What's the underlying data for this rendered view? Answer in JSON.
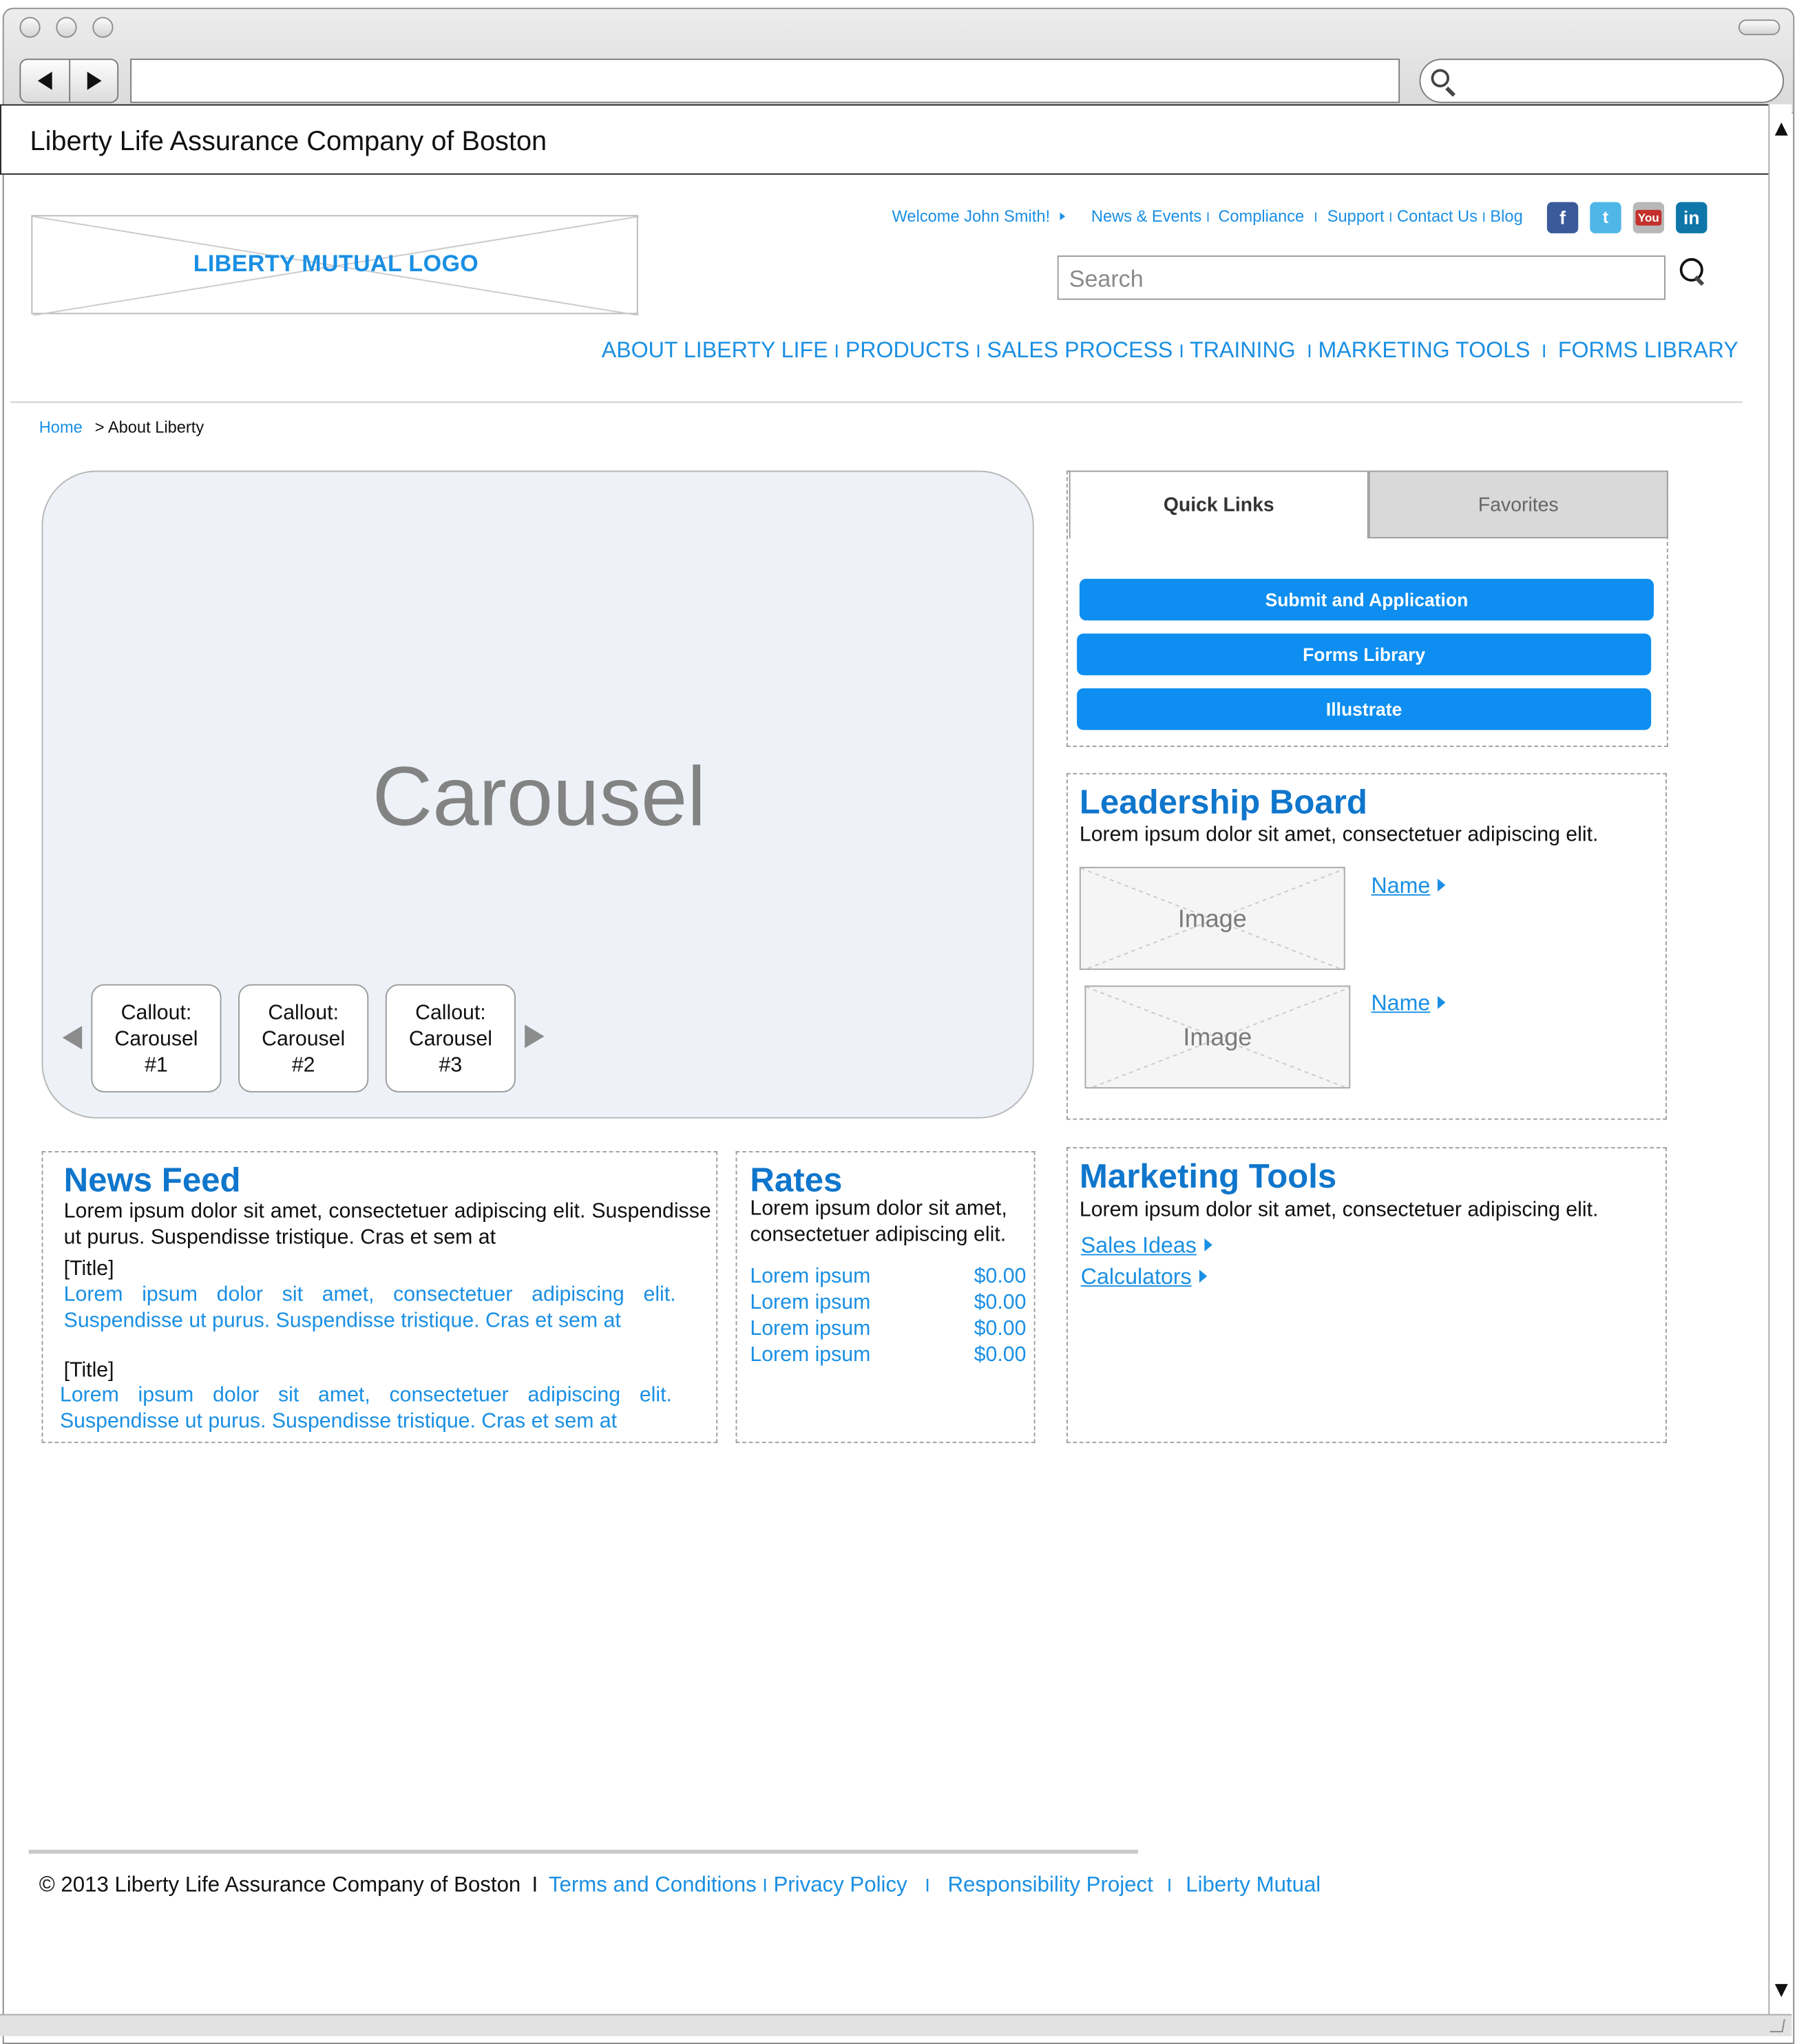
{
  "browser": {
    "url": "",
    "search": ""
  },
  "page_title": "Liberty Life Assurance Company of Boston",
  "logo_text": "LIBERTY MUTUAL LOGO",
  "top_links": {
    "welcome": "Welcome John Smith!",
    "news": "News & Events",
    "compliance": "Compliance",
    "support": "Support",
    "contact": "Contact Us",
    "blog": "Blog",
    "sep": "I"
  },
  "social": {
    "facebook": "f",
    "twitter": "t",
    "youtube": "You",
    "linkedin": "in"
  },
  "site_search": {
    "placeholder": "Search"
  },
  "main_nav": [
    "ABOUT LIBERTY LIFE",
    "PRODUCTS",
    "SALES PROCESS",
    "TRAINING",
    "MARKETING TOOLS",
    "FORMS LIBRARY"
  ],
  "breadcrumb": {
    "home": "Home",
    "sep": ">",
    "current": "About Liberty"
  },
  "carousel": {
    "label": "Carousel",
    "callouts": [
      {
        "line1": "Callout:",
        "line2": "Carousel",
        "line3": "#1"
      },
      {
        "line1": "Callout:",
        "line2": "Carousel",
        "line3": "#2"
      },
      {
        "line1": "Callout:",
        "line2": "Carousel",
        "line3": "#3"
      }
    ]
  },
  "tabs": {
    "quick_links": "Quick Links",
    "favorites": "Favorites"
  },
  "quick_links": [
    "Submit and Application",
    "Forms Library",
    "Illustrate"
  ],
  "leadership": {
    "title": "Leadership Board",
    "text": "Lorem ipsum dolor sit amet, consectetuer adipiscing elit.",
    "people": [
      {
        "image": "Image",
        "name": "Name"
      },
      {
        "image": "Image",
        "name": "Name"
      }
    ]
  },
  "news_feed": {
    "title": "News Feed",
    "intro": "Lorem ipsum dolor sit amet, consectetuer adipiscing elit. Suspendisse ut purus. Suspendisse tristique. Cras et sem at",
    "items": [
      {
        "title": "[Title]",
        "text": "Lorem ipsum dolor sit amet, consectetuer adipiscing elit. Suspendisse ut purus. Suspendisse tristique. Cras et sem at"
      },
      {
        "title": "[Title]",
        "text": "Lorem ipsum dolor sit amet, consectetuer adipiscing elit. Suspendisse ut purus. Suspendisse tristique. Cras et sem at"
      }
    ]
  },
  "rates": {
    "title": "Rates",
    "text": "Lorem ipsum dolor sit amet, consectetuer adipiscing elit.",
    "rows": [
      {
        "label": "Lorem ipsum",
        "value": "$0.00"
      },
      {
        "label": "Lorem ipsum",
        "value": "$0.00"
      },
      {
        "label": "Lorem ipsum",
        "value": "$0.00"
      },
      {
        "label": "Lorem ipsum",
        "value": "$0.00"
      }
    ]
  },
  "marketing": {
    "title": "Marketing Tools",
    "text": "Lorem ipsum dolor sit amet, consectetuer adipiscing elit.",
    "links": [
      "Sales Ideas",
      "Calculators"
    ]
  },
  "footer": {
    "copyright": "© 2013 Liberty Life Assurance Company of Boston",
    "sep": "I",
    "terms": "Terms and Conditions",
    "privacy": "Privacy Policy",
    "responsibility": "Responsibility Project",
    "liberty": "Liberty Mutual"
  },
  "colors": {
    "accent": "#1a8fe3",
    "heading": "#0f76cc",
    "button": "#0d8ef0",
    "carousel_bg": "#eef2f8"
  }
}
